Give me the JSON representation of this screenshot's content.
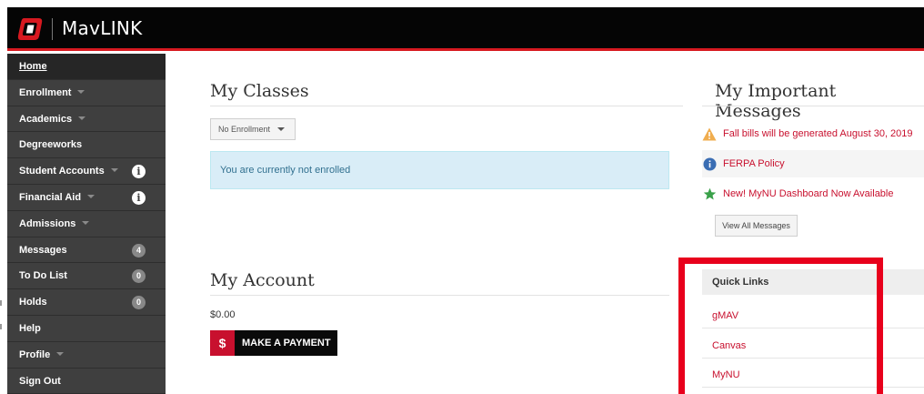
{
  "header": {
    "app_title": "MavLINK",
    "logo_icon": "university-o-logo-icon",
    "brand_color": "#d71920"
  },
  "sidebar": {
    "items": [
      {
        "label": "Home",
        "active": true
      },
      {
        "label": "Enrollment",
        "caret": true
      },
      {
        "label": "Academics",
        "caret": true
      },
      {
        "label": "Degreeworks"
      },
      {
        "label": "Student Accounts",
        "caret": true,
        "icon": "info-icon",
        "icon_text": "i"
      },
      {
        "label": "Financial Aid",
        "caret": true,
        "icon": "info-icon",
        "icon_text": "i"
      },
      {
        "label": "Admissions",
        "caret": true
      },
      {
        "label": "Messages",
        "badge": "4"
      },
      {
        "label": "To Do List",
        "badge": "0"
      },
      {
        "label": "Holds",
        "badge": "0"
      },
      {
        "label": "Help"
      },
      {
        "label": "Profile",
        "caret": true
      },
      {
        "label": "Sign Out"
      }
    ]
  },
  "classes": {
    "title": "My Classes",
    "dropdown_value": "No Enrollment",
    "alert_text": "You are currently not enrolled"
  },
  "account": {
    "title": "My Account",
    "balance": "$0.00",
    "pay_icon": "$",
    "pay_label": "MAKE A PAYMENT"
  },
  "messages": {
    "title": "My Important Messages",
    "items": [
      {
        "text": "Fall bills will be generated August 30, 2019",
        "icon": "warning-triangle-icon"
      },
      {
        "text": "FERPA Policy",
        "icon": "info-circle-icon"
      },
      {
        "text": "New! MyNU Dashboard Now Available",
        "icon": "star-icon"
      }
    ],
    "view_all_label": "View All Messages"
  },
  "quick_links": {
    "title": "Quick Links",
    "items": [
      "gMAV",
      "Canvas",
      "MyNU"
    ]
  },
  "colors": {
    "accent_red": "#c8102e",
    "highlight_red": "#e8001c",
    "alert_blue_bg": "#d9edf7",
    "sidebar_bg": "#3f3f3f"
  }
}
